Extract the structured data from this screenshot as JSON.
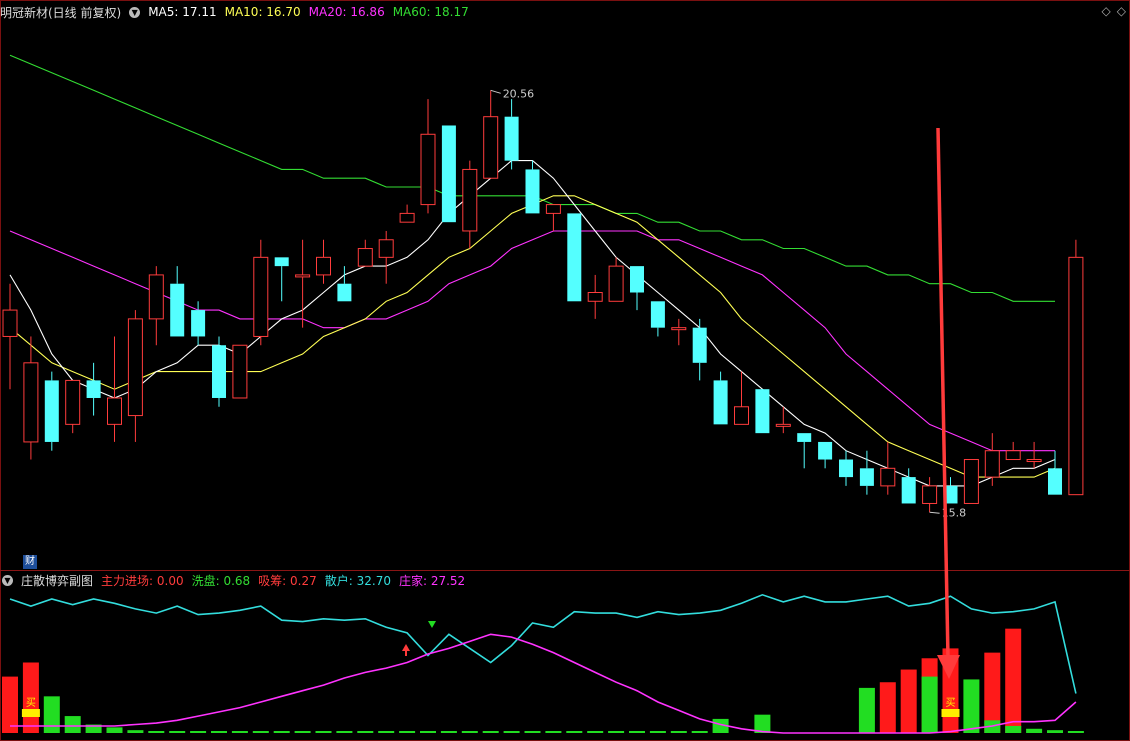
{
  "main_header": {
    "stock_name": "明冠新材(日线 前复权)",
    "ma5": "MA5: 17.11",
    "ma10": "MA10: 16.70",
    "ma20": "MA20: 16.86",
    "ma60": "MA60: 18.17"
  },
  "sub_header": {
    "title": "庄散博弈副图",
    "main_inflow": "主力进场: 0.00",
    "washout": "洗盘: 0.68",
    "absorb": "吸筹: 0.27",
    "retail": "散户: 32.70",
    "dealer": "庄家: 27.52"
  },
  "badges": {
    "cai": "财",
    "buy": "买"
  },
  "colors": {
    "bull": "#ff3c3c",
    "bear": "#54ffff",
    "ma5": "#ffffff",
    "ma10": "#ffff55",
    "ma20": "#ff33ff",
    "ma60": "#33dd33",
    "retail_line": "#33dddd",
    "dealer_line": "#ff33ff",
    "red_bar": "#ff1a1a",
    "green_bar": "#22dd22",
    "arrow": "#ff3b3b"
  },
  "chart_data": [
    {
      "type": "candlestick",
      "title": "明冠新材(日线 前复权)",
      "annotations": {
        "high_label": "20.56",
        "low_label": "15.8"
      },
      "ylim": [
        15.2,
        21.4
      ],
      "candles": [
        {
          "o": 17.8,
          "h": 18.4,
          "l": 17.2,
          "c": 18.1
        },
        {
          "o": 16.6,
          "h": 17.8,
          "l": 16.4,
          "c": 17.5
        },
        {
          "o": 17.3,
          "h": 17.4,
          "l": 16.5,
          "c": 16.6
        },
        {
          "o": 16.8,
          "h": 17.3,
          "l": 16.7,
          "c": 17.3
        },
        {
          "o": 17.3,
          "h": 17.5,
          "l": 16.9,
          "c": 17.1
        },
        {
          "o": 16.8,
          "h": 17.8,
          "l": 16.6,
          "c": 17.1
        },
        {
          "o": 16.9,
          "h": 18.1,
          "l": 16.6,
          "c": 18.0
        },
        {
          "o": 18.0,
          "h": 18.6,
          "l": 17.7,
          "c": 18.5
        },
        {
          "o": 18.4,
          "h": 18.6,
          "l": 17.8,
          "c": 17.8
        },
        {
          "o": 18.1,
          "h": 18.2,
          "l": 17.7,
          "c": 17.8
        },
        {
          "o": 17.7,
          "h": 17.8,
          "l": 17.0,
          "c": 17.1
        },
        {
          "o": 17.1,
          "h": 17.7,
          "l": 17.1,
          "c": 17.7
        },
        {
          "o": 17.8,
          "h": 18.9,
          "l": 17.7,
          "c": 18.7
        },
        {
          "o": 18.7,
          "h": 18.7,
          "l": 18.2,
          "c": 18.6
        },
        {
          "o": 18.5,
          "h": 18.9,
          "l": 17.9,
          "c": 18.5
        },
        {
          "o": 18.5,
          "h": 18.9,
          "l": 18.4,
          "c": 18.7
        },
        {
          "o": 18.4,
          "h": 18.6,
          "l": 18.2,
          "c": 18.2
        },
        {
          "o": 18.6,
          "h": 18.9,
          "l": 18.6,
          "c": 18.8
        },
        {
          "o": 18.7,
          "h": 19.0,
          "l": 18.4,
          "c": 18.9
        },
        {
          "o": 19.1,
          "h": 19.3,
          "l": 19.1,
          "c": 19.2
        },
        {
          "o": 19.3,
          "h": 20.5,
          "l": 19.2,
          "c": 20.1
        },
        {
          "o": 20.2,
          "h": 20.2,
          "l": 19.1,
          "c": 19.1
        },
        {
          "o": 19.0,
          "h": 19.8,
          "l": 18.8,
          "c": 19.7
        },
        {
          "o": 19.6,
          "h": 20.6,
          "l": 19.6,
          "c": 20.3
        },
        {
          "o": 20.3,
          "h": 20.5,
          "l": 19.7,
          "c": 19.8
        },
        {
          "o": 19.7,
          "h": 19.8,
          "l": 19.2,
          "c": 19.2
        },
        {
          "o": 19.2,
          "h": 19.3,
          "l": 19.0,
          "c": 19.3
        },
        {
          "o": 19.2,
          "h": 19.2,
          "l": 18.2,
          "c": 18.2
        },
        {
          "o": 18.2,
          "h": 18.5,
          "l": 18.0,
          "c": 18.3
        },
        {
          "o": 18.2,
          "h": 18.7,
          "l": 18.3,
          "c": 18.6
        },
        {
          "o": 18.6,
          "h": 18.6,
          "l": 18.1,
          "c": 18.3
        },
        {
          "o": 18.2,
          "h": 18.2,
          "l": 17.8,
          "c": 17.9
        },
        {
          "o": 17.9,
          "h": 18.0,
          "l": 17.7,
          "c": 17.9
        },
        {
          "o": 17.9,
          "h": 18.0,
          "l": 17.3,
          "c": 17.5
        },
        {
          "o": 17.3,
          "h": 17.4,
          "l": 16.8,
          "c": 16.8
        },
        {
          "o": 16.8,
          "h": 17.4,
          "l": 16.8,
          "c": 17.0
        },
        {
          "o": 17.2,
          "h": 17.2,
          "l": 16.7,
          "c": 16.7
        },
        {
          "o": 16.8,
          "h": 17.0,
          "l": 16.7,
          "c": 16.8
        },
        {
          "o": 16.7,
          "h": 16.7,
          "l": 16.3,
          "c": 16.6
        },
        {
          "o": 16.6,
          "h": 16.6,
          "l": 16.3,
          "c": 16.4
        },
        {
          "o": 16.4,
          "h": 16.5,
          "l": 16.1,
          "c": 16.2
        },
        {
          "o": 16.3,
          "h": 16.5,
          "l": 16.0,
          "c": 16.1
        },
        {
          "o": 16.1,
          "h": 16.6,
          "l": 16.0,
          "c": 16.3
        },
        {
          "o": 16.2,
          "h": 16.3,
          "l": 15.9,
          "c": 15.9
        },
        {
          "o": 15.9,
          "h": 16.2,
          "l": 15.8,
          "c": 16.1
        },
        {
          "o": 16.1,
          "h": 16.2,
          "l": 15.9,
          "c": 15.9
        },
        {
          "o": 15.9,
          "h": 16.4,
          "l": 15.9,
          "c": 16.4
        },
        {
          "o": 16.2,
          "h": 16.7,
          "l": 16.1,
          "c": 16.5
        },
        {
          "o": 16.4,
          "h": 16.6,
          "l": 16.4,
          "c": 16.5
        },
        {
          "o": 16.4,
          "h": 16.6,
          "l": 16.3,
          "c": 16.4
        },
        {
          "o": 16.3,
          "h": 16.5,
          "l": 16.0,
          "c": 16.0
        },
        {
          "o": 16.0,
          "h": 18.9,
          "l": 16.0,
          "c": 18.7
        }
      ],
      "ma5": [
        18.5,
        18.1,
        17.6,
        17.3,
        17.2,
        17.1,
        17.2,
        17.4,
        17.5,
        17.7,
        17.7,
        17.6,
        17.8,
        18.0,
        18.1,
        18.3,
        18.5,
        18.6,
        18.6,
        18.7,
        18.9,
        19.2,
        19.4,
        19.6,
        19.8,
        19.8,
        19.6,
        19.3,
        19.0,
        18.7,
        18.5,
        18.3,
        18.1,
        17.9,
        17.6,
        17.4,
        17.2,
        17.0,
        16.8,
        16.7,
        16.5,
        16.4,
        16.3,
        16.2,
        16.1,
        16.1,
        16.1,
        16.2,
        16.3,
        16.3,
        16.4
      ],
      "ma10": [
        17.9,
        17.7,
        17.5,
        17.4,
        17.3,
        17.2,
        17.3,
        17.4,
        17.4,
        17.4,
        17.4,
        17.4,
        17.4,
        17.5,
        17.6,
        17.8,
        17.9,
        18.0,
        18.2,
        18.3,
        18.5,
        18.7,
        18.8,
        19.0,
        19.2,
        19.3,
        19.4,
        19.4,
        19.3,
        19.2,
        19.1,
        18.9,
        18.7,
        18.5,
        18.3,
        18.0,
        17.8,
        17.6,
        17.4,
        17.2,
        17.0,
        16.8,
        16.6,
        16.5,
        16.4,
        16.3,
        16.2,
        16.2,
        16.2,
        16.2,
        16.3
      ],
      "ma20": [
        19.0,
        18.9,
        18.8,
        18.7,
        18.6,
        18.5,
        18.4,
        18.3,
        18.2,
        18.1,
        18.1,
        18.0,
        18.0,
        18.0,
        18.0,
        17.9,
        17.9,
        18.0,
        18.0,
        18.1,
        18.2,
        18.4,
        18.5,
        18.6,
        18.8,
        18.9,
        19.0,
        19.0,
        19.0,
        19.0,
        19.0,
        18.9,
        18.9,
        18.8,
        18.7,
        18.6,
        18.5,
        18.3,
        18.1,
        17.9,
        17.6,
        17.4,
        17.2,
        17.0,
        16.8,
        16.7,
        16.6,
        16.5,
        16.5,
        16.5,
        16.5
      ],
      "ma60": [
        21.0,
        20.9,
        20.8,
        20.7,
        20.6,
        20.5,
        20.4,
        20.3,
        20.2,
        20.1,
        20.0,
        19.9,
        19.8,
        19.7,
        19.7,
        19.6,
        19.6,
        19.6,
        19.5,
        19.5,
        19.5,
        19.4,
        19.4,
        19.4,
        19.4,
        19.4,
        19.3,
        19.3,
        19.3,
        19.2,
        19.2,
        19.1,
        19.1,
        19.0,
        19.0,
        18.9,
        18.9,
        18.8,
        18.8,
        18.7,
        18.6,
        18.6,
        18.5,
        18.5,
        18.4,
        18.4,
        18.3,
        18.3,
        18.2,
        18.2,
        18.2
      ]
    },
    {
      "type": "bar",
      "title": "庄散博弈副图",
      "ylim": [
        0,
        100
      ],
      "series": [
        {
          "name": "散户",
          "values": [
            95,
            90,
            95,
            91,
            95,
            92,
            88,
            85,
            90,
            84,
            85,
            87,
            90,
            80,
            79,
            81,
            80,
            81,
            75,
            71,
            55,
            70,
            60,
            50,
            62,
            78,
            75,
            86,
            85,
            85,
            82,
            86,
            84,
            85,
            87,
            92,
            98,
            93,
            97,
            93,
            93,
            95,
            97,
            90,
            92,
            97,
            88,
            85,
            86,
            88,
            93,
            28
          ]
        },
        {
          "name": "庄家",
          "values": [
            5,
            5,
            5,
            5,
            5,
            5,
            6,
            7,
            9,
            12,
            15,
            18,
            22,
            26,
            30,
            34,
            39,
            43,
            46,
            50,
            56,
            60,
            65,
            70,
            68,
            63,
            57,
            50,
            43,
            36,
            30,
            22,
            16,
            10,
            6,
            3,
            1,
            0,
            0,
            0,
            0,
            0,
            0,
            0,
            0,
            1,
            3,
            5,
            8,
            8,
            9,
            22
          ]
        }
      ],
      "red_bars": [
        40,
        50,
        0,
        0,
        0,
        0,
        0,
        0,
        0,
        0,
        0,
        0,
        0,
        0,
        0,
        0,
        0,
        0,
        0,
        0,
        0,
        0,
        0,
        0,
        0,
        0,
        0,
        0,
        0,
        0,
        0,
        0,
        0,
        0,
        0,
        0,
        0,
        0,
        0,
        0,
        0,
        0,
        36,
        45,
        53,
        60,
        0,
        57,
        74,
        0,
        0,
        0
      ],
      "green_bars": [
        0,
        0,
        26,
        12,
        6,
        4,
        2,
        1,
        1,
        1,
        1,
        1,
        1,
        1,
        1,
        1,
        1,
        1,
        1,
        1,
        1,
        1,
        1,
        1,
        1,
        1,
        1,
        1,
        1,
        1,
        1,
        1,
        1,
        1,
        10,
        0,
        13,
        0,
        0,
        0,
        0,
        32,
        0,
        0,
        40,
        0,
        38,
        9,
        5,
        3,
        2,
        1
      ],
      "yellow_markers": [
        1,
        45
      ]
    }
  ]
}
